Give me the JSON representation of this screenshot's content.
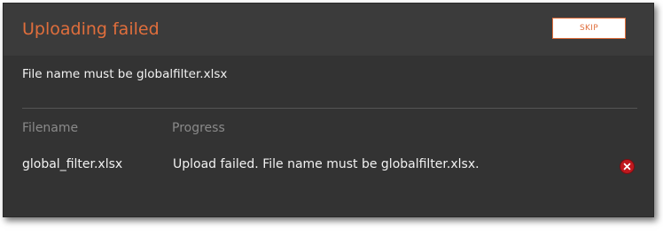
{
  "dialog": {
    "title": "Uploading failed",
    "skip_label": "SKIP",
    "message": "File name must be globalfilter.xlsx"
  },
  "table": {
    "columns": [
      "Filename",
      "Progress"
    ],
    "rows": [
      {
        "filename": "global_filter.xlsx",
        "progress": "Upload failed. File name must be globalfilter.xlsx."
      }
    ]
  },
  "icons": {
    "remove": "remove-icon"
  },
  "colors": {
    "accent": "#e06e3c",
    "error": "#c0181e",
    "background": "#333333",
    "header_background": "#3b3b3b"
  }
}
